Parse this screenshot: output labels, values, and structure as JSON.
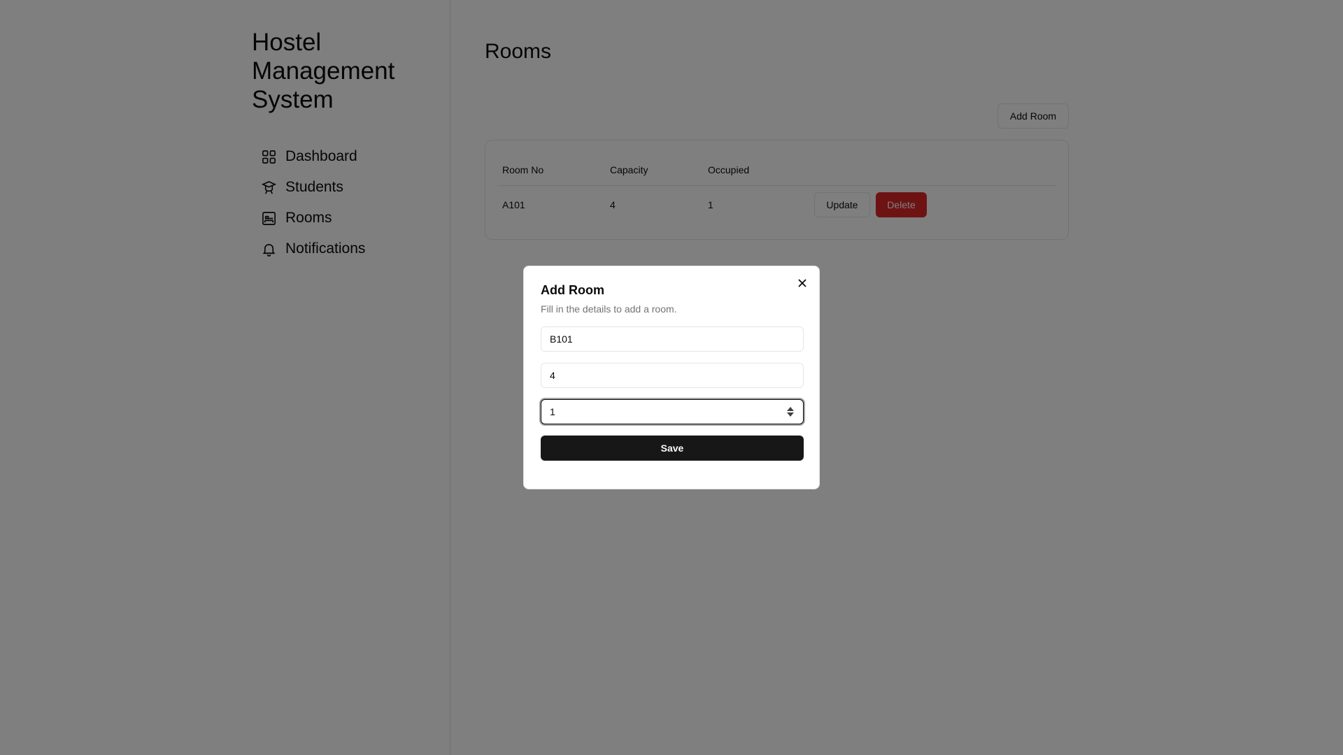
{
  "sidebar": {
    "brand": "Hostel Management System",
    "items": [
      {
        "label": "Dashboard",
        "icon": "dashboard-grid-icon"
      },
      {
        "label": "Students",
        "icon": "graduation-cap-icon"
      },
      {
        "label": "Rooms",
        "icon": "bed-icon"
      },
      {
        "label": "Notifications",
        "icon": "bell-icon"
      }
    ]
  },
  "main": {
    "title": "Rooms",
    "add_room_label": "Add Room",
    "table": {
      "headers": [
        "Room No",
        "Capacity",
        "Occupied"
      ],
      "rows": [
        {
          "room_no": "A101",
          "capacity": "4",
          "occupied": "1",
          "update_label": "Update",
          "delete_label": "Delete"
        }
      ]
    }
  },
  "modal": {
    "title": "Add Room",
    "description": "Fill in the details to add a room.",
    "room_no_value": "B101",
    "capacity_value": "4",
    "occupied_value": "1",
    "save_label": "Save"
  },
  "colors": {
    "delete": "#dc2626",
    "primary": "#171717",
    "overlay": "rgba(0,0,0,0.5)"
  }
}
